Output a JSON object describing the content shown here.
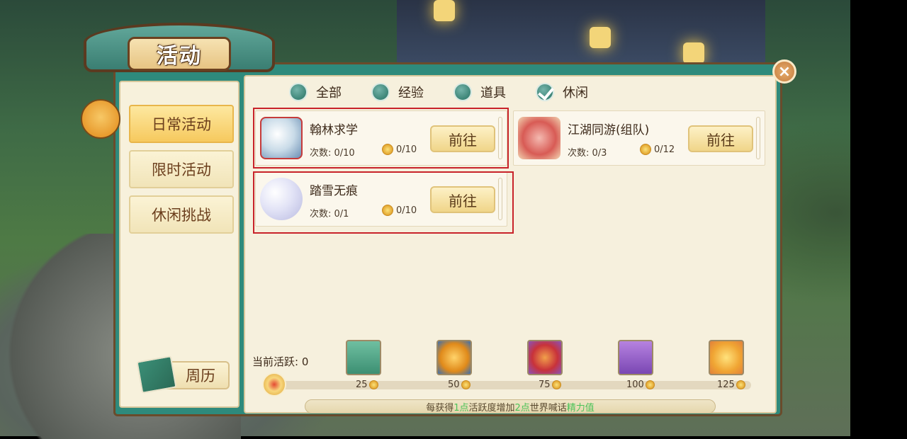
{
  "title": "活动",
  "close_label": "×",
  "filters": [
    {
      "label": "全部",
      "checked": false
    },
    {
      "label": "经验",
      "checked": false
    },
    {
      "label": "道具",
      "checked": false
    },
    {
      "label": "休闲",
      "checked": true
    }
  ],
  "sidebar": {
    "tabs": [
      {
        "label": "日常活动",
        "active": true
      },
      {
        "label": "限时活动",
        "active": false
      },
      {
        "label": "休闲挑战",
        "active": false
      }
    ],
    "calendar_label": "周历"
  },
  "activities": [
    {
      "name": "翰林求学",
      "count": "次数: 0/10",
      "points": "0/10",
      "button": "前往",
      "highlighted": true,
      "icon": "book-icon"
    },
    {
      "name": "江湖同游(组队)",
      "count": "次数: 0/3",
      "points": "0/12",
      "button": "前往",
      "highlighted": false,
      "icon": "heart-icon"
    },
    {
      "name": "踏雪无痕",
      "count": "次数: 0/1",
      "points": "0/10",
      "button": "前往",
      "highlighted": true,
      "icon": "snowball-icon"
    }
  ],
  "progress": {
    "label": "当前活跃: 0",
    "value": 0,
    "milestones": [
      "25",
      "50",
      "75",
      "100",
      "125"
    ],
    "reward_icons": [
      "sand-icon",
      "crystal-ball-icon",
      "red-pouch-icon",
      "green-book-icon",
      "gold-ingot-icon"
    ]
  },
  "footer": {
    "p1": "每获得",
    "hl1": "1点",
    "p2": "活跃度增加",
    "hl2": "2点",
    "p3": "世界喊话",
    "hl3": "精力值"
  },
  "colors": {
    "accent_teal": "#2e8a7c",
    "highlight_red": "#c8232a",
    "button_gold": "#f0d589",
    "footer_highlight": "#4cc35a"
  }
}
